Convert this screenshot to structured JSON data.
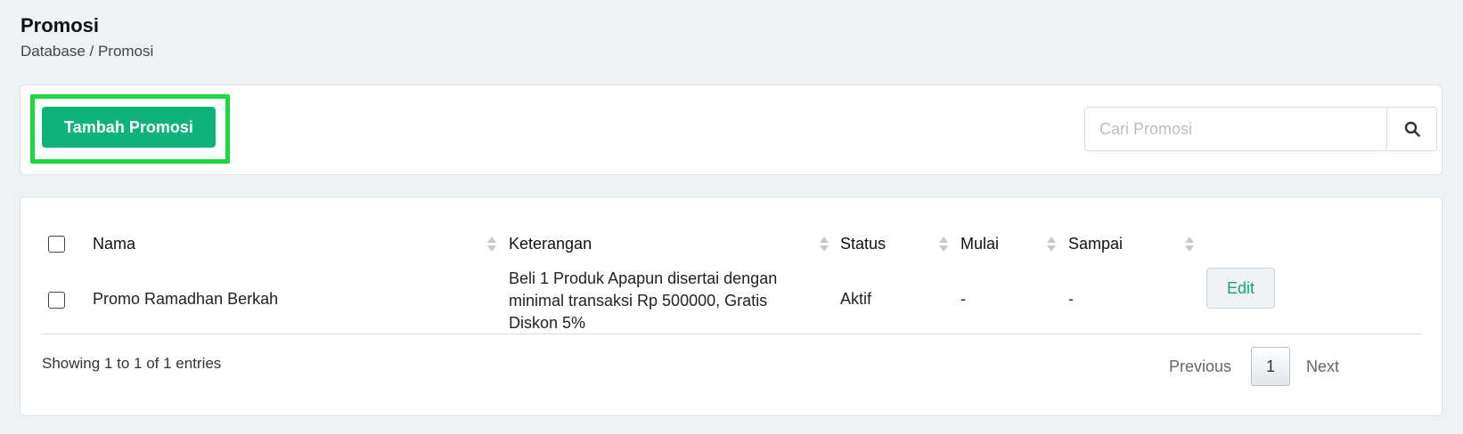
{
  "header": {
    "title": "Promosi",
    "breadcrumb": "Database / Promosi"
  },
  "toolbar": {
    "add_label": "Tambah Promosi",
    "search_placeholder": "Cari Promosi",
    "search_value": ""
  },
  "table": {
    "columns": [
      "Nama",
      "Keterangan",
      "Status",
      "Mulai",
      "Sampai"
    ],
    "rows": [
      {
        "nama": "Promo Ramadhan Berkah",
        "keterangan": "Beli 1 Produk Apapun disertai dengan minimal transaksi Rp 500000, Gratis Diskon 5%",
        "status": "Aktif",
        "mulai": "-",
        "sampai": "-",
        "action": "Edit"
      }
    ],
    "info": "Showing 1 to 1 of 1 entries"
  },
  "pagination": {
    "previous": "Previous",
    "current": "1",
    "next": "Next"
  },
  "colors": {
    "primary": "#10b27c",
    "highlight": "#1ed641",
    "background": "#eff2f5"
  },
  "icons": {
    "search": "search-icon",
    "sort": "sort-icon"
  }
}
